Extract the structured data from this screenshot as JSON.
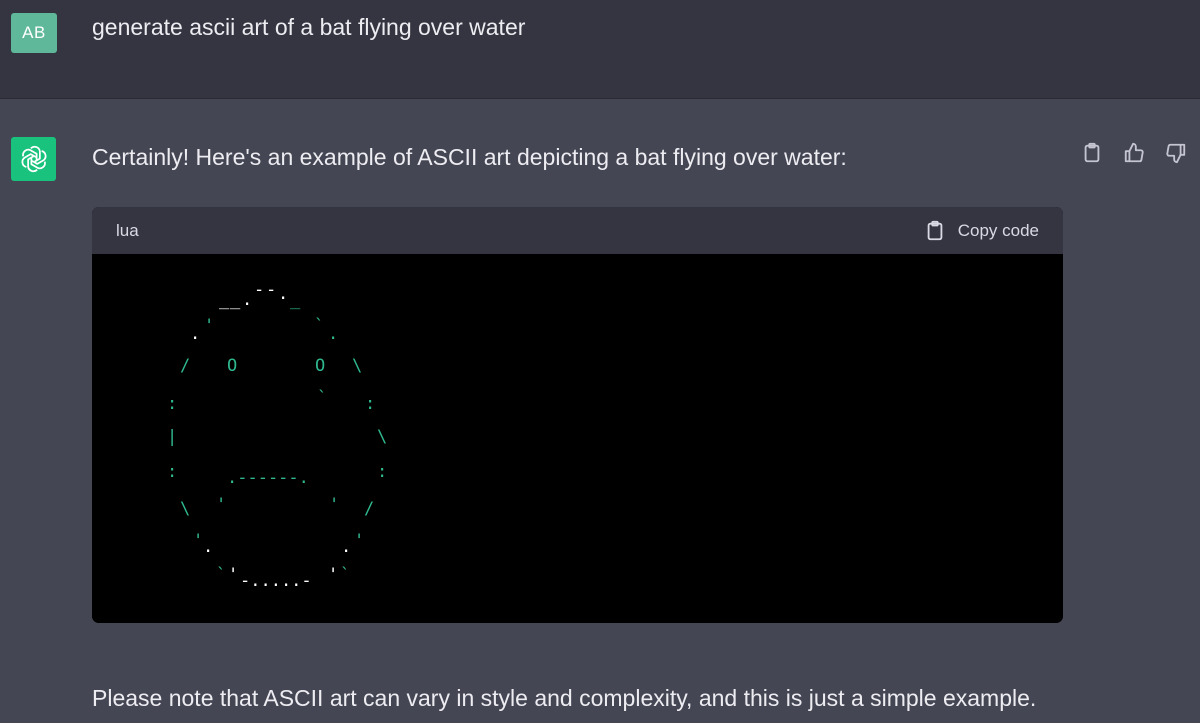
{
  "user": {
    "avatar_initials": "AB",
    "message": "generate ascii art of a bat flying over water"
  },
  "assistant": {
    "intro": "Certainly! Here's an example of ASCII art depicting a bat flying over water:",
    "actions": [
      "clipboard-icon",
      "thumbs-up-icon",
      "thumbs-down-icon"
    ],
    "code_block": {
      "language": "lua",
      "copy_label": "Copy code",
      "ascii_lines": [
        "         _..--._",
        "       .'       `.",
        "      /   O    O  \\",
        "     :        `   :",
        "     |             \\",
        "     :     .------.  :",
        "      \\   '      '  /",
        "       '.          .'",
        "         `'-.....-'`"
      ]
    },
    "footer": "Please note that ASCII art can vary in style and complexity, and this is just a simple example."
  },
  "colors": {
    "user_row_bg": "#343541",
    "assistant_row_bg": "#444654",
    "user_avatar_bg": "#5fb89a",
    "bot_avatar_bg": "#19c37d",
    "code_bg": "#000000",
    "code_header_bg": "#343541",
    "ascii_green": "#2fb98f"
  }
}
